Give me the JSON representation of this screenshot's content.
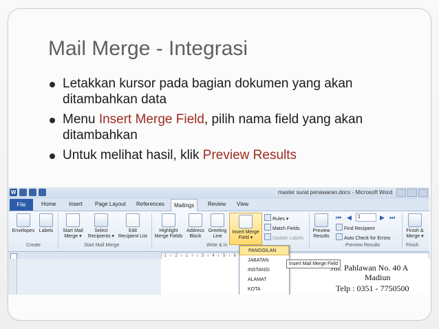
{
  "slide": {
    "title": "Mail Merge - Integrasi",
    "bullets": [
      {
        "before": "Letakkan kursor pada bagian dokumen yang akan ditambahkan data",
        "highlight": "",
        "after": ""
      },
      {
        "before": "Menu ",
        "highlight": "Insert Merge Field",
        "after": ", pilih nama field yang akan ditambahkan"
      },
      {
        "before": "Untuk melihat hasil, klik ",
        "highlight": "Preview Results",
        "after": ""
      }
    ],
    "highlight_color": "#9e2a1e"
  },
  "word": {
    "window_title": "master surat penawaran.docx - Microsoft Word",
    "tabs": [
      "File",
      "Home",
      "Insert",
      "Page Layout",
      "References",
      "Mailings",
      "Review",
      "View"
    ],
    "active_tab": "Mailings",
    "ribbon": {
      "envelopes": "Envelopes",
      "labels": "Labels",
      "start_mail_merge": [
        "Start Mail",
        "Merge ▾"
      ],
      "select_recipients": [
        "Select",
        "Recipients ▾"
      ],
      "edit_recipient_list": [
        "Edit",
        "Recipient List"
      ],
      "highlight_merge_fields": [
        "Highlight",
        "Merge Fields"
      ],
      "address_block": [
        "Address",
        "Block"
      ],
      "greeting_line": [
        "Greeting",
        "Line"
      ],
      "insert_merge_field": [
        "Insert Merge",
        "Field ▾"
      ],
      "rules": "Rules ▾",
      "match_fields": "Match Fields",
      "update_labels": "Update Labels",
      "preview_results": [
        "Preview",
        "Results"
      ],
      "record_number": "1",
      "find_recipient": "Find Recipient",
      "auto_check": "Auto Check for Errors",
      "finish_merge": [
        "Finish &",
        "Merge ▾"
      ]
    },
    "groups": [
      "Create",
      "Start Mail Merge",
      "Write & In",
      "Preview Results",
      "Finish"
    ],
    "ruler_text": "· 1 · ı · 2 · ı · 1 · ı · ı · 3 · ı · 4 · ı · 5 · ı · 6 · ı · 7 · ı · 8 · ı · 9 · ı · 10 · ı ·",
    "merge_fields": [
      "PANGGILAN",
      "JABATAN",
      "INSTANSI",
      "ALAMAT",
      "KOTA"
    ],
    "selected_field": "PANGGILAN",
    "tooltip": "Insert Mail Merge Field",
    "document_lines": [
      "Jln. Pahlawan No. 40 A",
      "Madiun",
      "Telp : 0351 - 7750500"
    ]
  }
}
